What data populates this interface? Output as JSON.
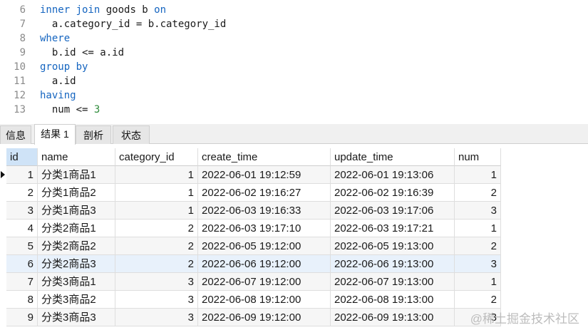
{
  "editor": {
    "lines": [
      {
        "no": "6",
        "segments": [
          {
            "t": "inner join",
            "c": "kw"
          },
          {
            "t": " goods b ",
            "c": ""
          },
          {
            "t": "on",
            "c": "kw"
          }
        ]
      },
      {
        "no": "7",
        "segments": [
          {
            "t": "  a.category_id = b.category_id",
            "c": ""
          }
        ]
      },
      {
        "no": "8",
        "segments": [
          {
            "t": "where",
            "c": "kw"
          }
        ]
      },
      {
        "no": "9",
        "segments": [
          {
            "t": "  b.id <= a.id",
            "c": ""
          }
        ]
      },
      {
        "no": "10",
        "segments": [
          {
            "t": "group by",
            "c": "kw"
          }
        ]
      },
      {
        "no": "11",
        "segments": [
          {
            "t": "  a.id",
            "c": ""
          }
        ]
      },
      {
        "no": "12",
        "segments": [
          {
            "t": "having",
            "c": "kw"
          }
        ]
      },
      {
        "no": "13",
        "segments": [
          {
            "t": "  num <= ",
            "c": ""
          },
          {
            "t": "3",
            "c": "num"
          }
        ]
      }
    ]
  },
  "tabs": [
    "信息",
    "结果 1",
    "剖析",
    "状态"
  ],
  "active_tab": "结果 1",
  "grid": {
    "columns": [
      "id",
      "name",
      "category_id",
      "create_time",
      "update_time",
      "num"
    ],
    "rows": [
      [
        "1",
        "分类1商品1",
        "1",
        "2022-06-01 19:12:59",
        "2022-06-01 19:13:06",
        "1"
      ],
      [
        "2",
        "分类1商品2",
        "1",
        "2022-06-02 19:16:27",
        "2022-06-02 19:16:39",
        "2"
      ],
      [
        "3",
        "分类1商品3",
        "1",
        "2022-06-03 19:16:33",
        "2022-06-03 19:17:06",
        "3"
      ],
      [
        "4",
        "分类2商品1",
        "2",
        "2022-06-03 19:17:10",
        "2022-06-03 19:17:21",
        "1"
      ],
      [
        "5",
        "分类2商品2",
        "2",
        "2022-06-05 19:12:00",
        "2022-06-05 19:13:00",
        "2"
      ],
      [
        "6",
        "分类2商品3",
        "2",
        "2022-06-06 19:12:00",
        "2022-06-06 19:13:00",
        "3"
      ],
      [
        "7",
        "分类3商品1",
        "3",
        "2022-06-07 19:12:00",
        "2022-06-07 19:13:00",
        "1"
      ],
      [
        "8",
        "分类3商品2",
        "3",
        "2022-06-08 19:12:00",
        "2022-06-08 19:13:00",
        "2"
      ],
      [
        "9",
        "分类3商品3",
        "3",
        "2022-06-09 19:12:00",
        "2022-06-09 19:13:00",
        "3"
      ]
    ]
  },
  "watermark": "@稀土掘金技术社区",
  "colors": {
    "keyword": "#1565c0",
    "number": "#2e8b3a",
    "selected_row": "#e8f1fb",
    "id_header": "#cfe3f7"
  }
}
